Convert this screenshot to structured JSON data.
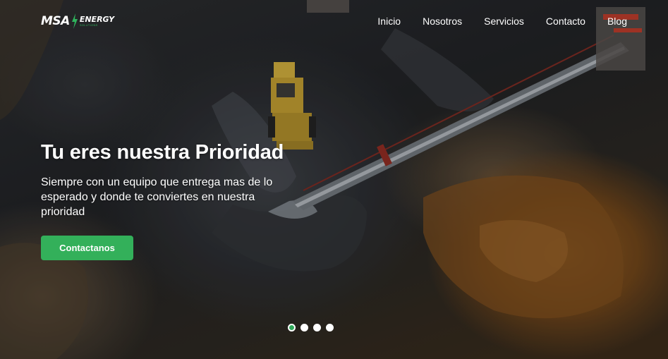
{
  "brand": {
    "logo_main": "MSA",
    "logo_energy": "ENERGY",
    "logo_sub": "SOLUTIONS"
  },
  "nav": {
    "items": [
      {
        "label": "Inicio"
      },
      {
        "label": "Nosotros"
      },
      {
        "label": "Servicios"
      },
      {
        "label": "Contacto"
      },
      {
        "label": "Blog"
      }
    ]
  },
  "hero": {
    "title": "Tu eres nuestra Prioridad",
    "subtitle": "Siempre con un equipo que entrega mas de lo esperado y donde te conviertes en nuestra prioridad",
    "cta_label": "Contactanos",
    "slides_total": 4,
    "active_slide": 1
  },
  "colors": {
    "accent": "#33b05a",
    "text": "#ffffff"
  },
  "icons": {
    "logo_bolt": "lightning-bolt-icon"
  }
}
